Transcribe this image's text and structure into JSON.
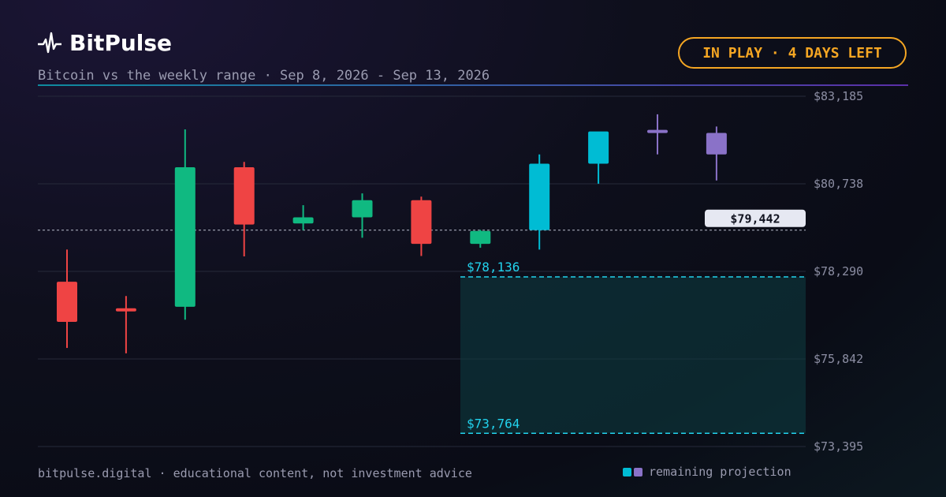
{
  "header": {
    "brand": "BitPulse",
    "subtitle": "Bitcoin vs the weekly range · Sep 8, 2026 - Sep 13, 2026",
    "status_badge": "IN PLAY · 4 DAYS LEFT"
  },
  "footer": {
    "text": "bitpulse.digital · educational content, not investment advice"
  },
  "legend": {
    "label": "remaining projection",
    "swatch_colors": [
      "#00bcd4",
      "#8a72c8"
    ]
  },
  "colors": {
    "up": "#10b981",
    "down": "#ef4444",
    "projection_a": "#00bcd4",
    "projection_b": "#8a72c8",
    "range": "#22d3ee",
    "badge": "#f5a623",
    "divider": [
      "#0e8a9e",
      "#5b2fa8"
    ]
  },
  "chart_data": {
    "type": "candlestick",
    "y_axis_ticks": [
      "$83,185",
      "$80,738",
      "$78,290",
      "$75,842",
      "$73,395"
    ],
    "y_tick_values": [
      83185,
      80738,
      78290,
      75842,
      73395
    ],
    "ylim": [
      73395,
      83185
    ],
    "grid": true,
    "candles": [
      {
        "open": 78000,
        "high": 78900,
        "low": 76150,
        "close": 76880,
        "kind": "down"
      },
      {
        "open": 77250,
        "high": 77600,
        "low": 76000,
        "close": 77180,
        "kind": "down"
      },
      {
        "open": 77300,
        "high": 82260,
        "low": 76940,
        "close": 81200,
        "kind": "up"
      },
      {
        "open": 81200,
        "high": 81350,
        "low": 78710,
        "close": 79600,
        "kind": "down"
      },
      {
        "open": 79630,
        "high": 80140,
        "low": 79440,
        "close": 79800,
        "kind": "up"
      },
      {
        "open": 79800,
        "high": 80470,
        "low": 79230,
        "close": 80280,
        "kind": "up"
      },
      {
        "open": 80280,
        "high": 80380,
        "low": 78720,
        "close": 79060,
        "kind": "down"
      },
      {
        "open": 79060,
        "high": 79450,
        "low": 78950,
        "close": 79420,
        "kind": "up"
      },
      {
        "open": 79442,
        "high": 81560,
        "low": 78900,
        "close": 81300,
        "kind": "projection_a"
      },
      {
        "open": 81300,
        "high": 81735,
        "low": 80740,
        "close": 82200,
        "kind": "projection_a"
      },
      {
        "open": 82200,
        "high": 82680,
        "low": 81560,
        "close": 82200,
        "kind": "projection_b"
      },
      {
        "open": 81560,
        "high": 82340,
        "low": 80830,
        "close": 82160,
        "kind": "projection_b"
      }
    ],
    "current_price": {
      "label": "$79,442",
      "value": 79442
    },
    "range": {
      "upper": {
        "label": "$78,136",
        "value": 78136
      },
      "lower": {
        "label": "$73,764",
        "value": 73764
      }
    }
  }
}
